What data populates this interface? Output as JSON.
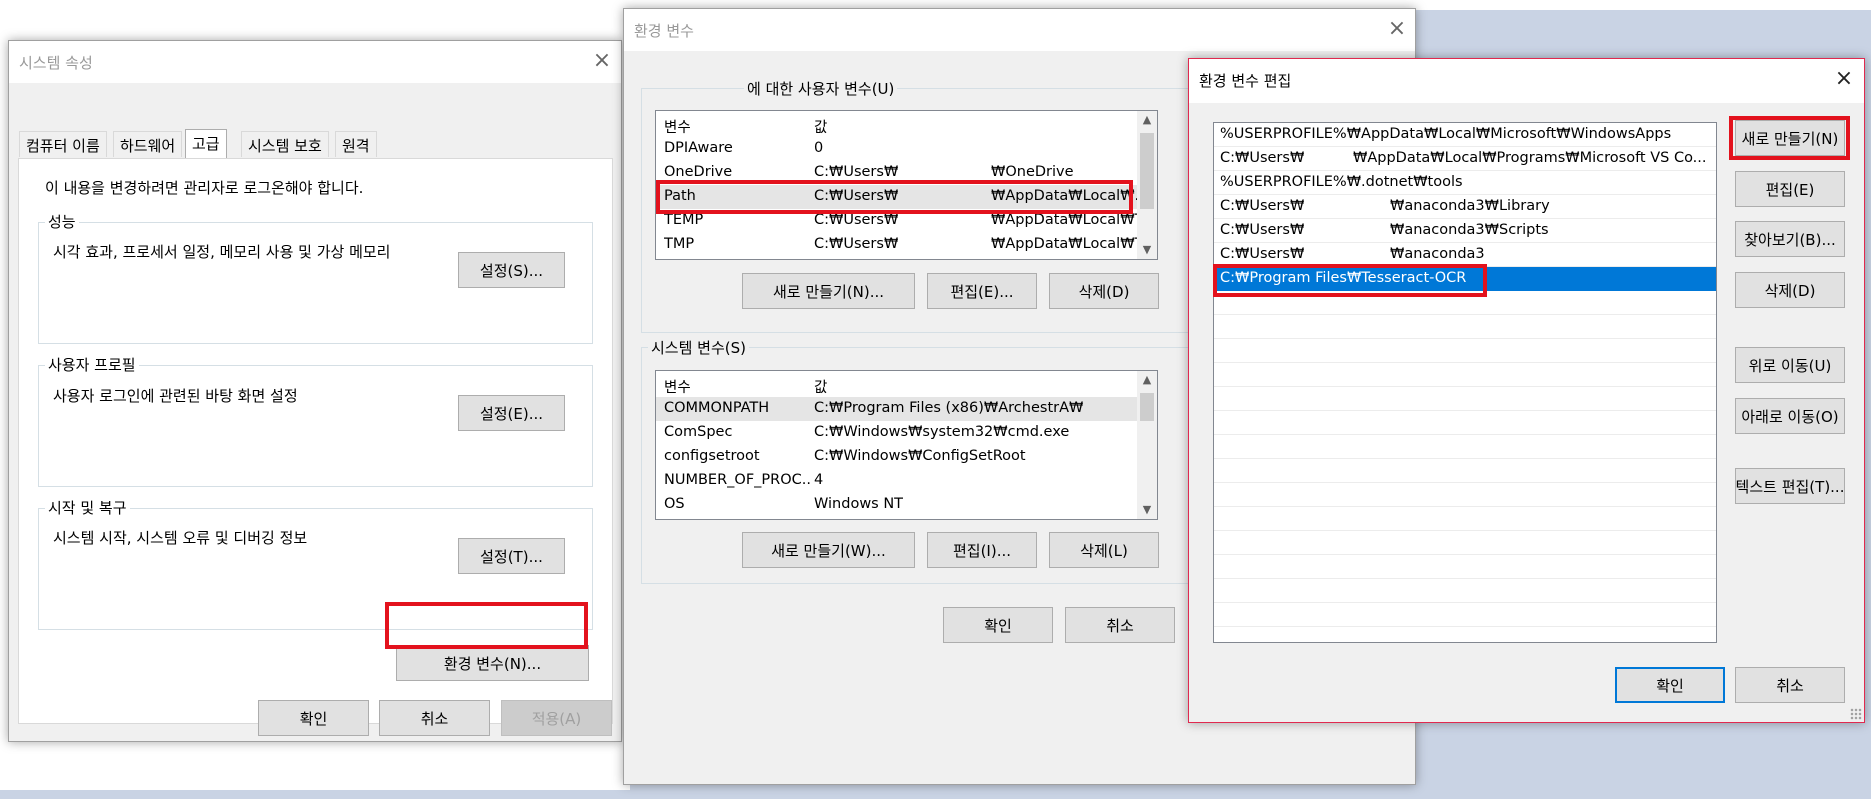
{
  "sysprop": {
    "title": "시스템 속성",
    "tabs": [
      "컴퓨터 이름",
      "하드웨어",
      "고급",
      "시스템 보호",
      "원격"
    ],
    "admin_note": "이 내용을 변경하려면 관리자로 로그온해야 합니다.",
    "perf": {
      "label": "성능",
      "desc": "시각 효과, 프로세서 일정, 메모리 사용 및 가상 메모리",
      "button": "설정(S)..."
    },
    "profile": {
      "label": "사용자 프로필",
      "desc": "사용자 로그인에 관련된 바탕 화면 설정",
      "button": "설정(E)..."
    },
    "startup": {
      "label": "시작 및 복구",
      "desc": "시스템 시작, 시스템 오류 및 디버깅 정보",
      "button": "설정(T)..."
    },
    "env_button": "환경 변수(N)...",
    "ok": "확인",
    "cancel": "취소",
    "apply": "적용(A)"
  },
  "envvars": {
    "title": "환경 변수",
    "user_group_label": "에 대한 사용자 변수(U)",
    "user_vars": {
      "headers": [
        "변수",
        "값"
      ],
      "rows": [
        {
          "name": "DPIAware",
          "value": "0",
          "tail": ""
        },
        {
          "name": "OneDrive",
          "value": "C:₩Users₩",
          "tail": "₩OneDrive"
        },
        {
          "name": "Path",
          "value": "C:₩Users₩",
          "tail": "₩AppData₩Local₩..."
        },
        {
          "name": "TEMP",
          "value": "C:₩Users₩",
          "tail": "₩AppData₩Local₩T..."
        },
        {
          "name": "TMP",
          "value": "C:₩Users₩",
          "tail": "₩AppData₩Local₩T..."
        }
      ]
    },
    "user_buttons": {
      "new": "새로 만들기(N)...",
      "edit": "편집(E)...",
      "delete": "삭제(D)"
    },
    "sys_group_label": "시스템 변수(S)",
    "sys_vars": {
      "headers": [
        "변수",
        "값"
      ],
      "rows": [
        {
          "name": "COMMONPATH",
          "value": "C:₩Program Files (x86)₩ArchestrA₩"
        },
        {
          "name": "ComSpec",
          "value": "C:₩Windows₩system32₩cmd.exe"
        },
        {
          "name": "configsetroot",
          "value": "C:₩Windows₩ConfigSetRoot"
        },
        {
          "name": "NUMBER_OF_PROC...",
          "value": "4"
        },
        {
          "name": "OS",
          "value": "Windows NT"
        }
      ]
    },
    "sys_buttons": {
      "new": "새로 만들기(W)...",
      "edit": "편집(I)...",
      "delete": "삭제(L)"
    },
    "ok": "확인",
    "cancel": "취소"
  },
  "editenv": {
    "title": "환경 변수 편집",
    "paths": [
      "%USERPROFILE%₩AppData₩Local₩Microsoft₩WindowsApps",
      "C:₩Users₩",
      "%USERPROFILE%₩.dotnet₩tools",
      "C:₩Users₩",
      "C:₩Users₩",
      "C:₩Users₩",
      "C:₩Program Files₩Tesseract-OCR"
    ],
    "path_tails": [
      "",
      "₩AppData₩Local₩Programs₩Microsoft VS Co...",
      "",
      "₩anaconda3₩Library",
      "₩anaconda3₩Scripts",
      "₩anaconda3",
      ""
    ],
    "buttons": {
      "new": "새로 만들기(N)",
      "edit": "편집(E)",
      "browse": "찾아보기(B)...",
      "delete": "삭제(D)",
      "move_up": "위로 이동(U)",
      "move_down": "아래로 이동(O)",
      "edit_text": "텍스트 편집(T)..."
    },
    "ok": "확인",
    "cancel": "취소"
  }
}
